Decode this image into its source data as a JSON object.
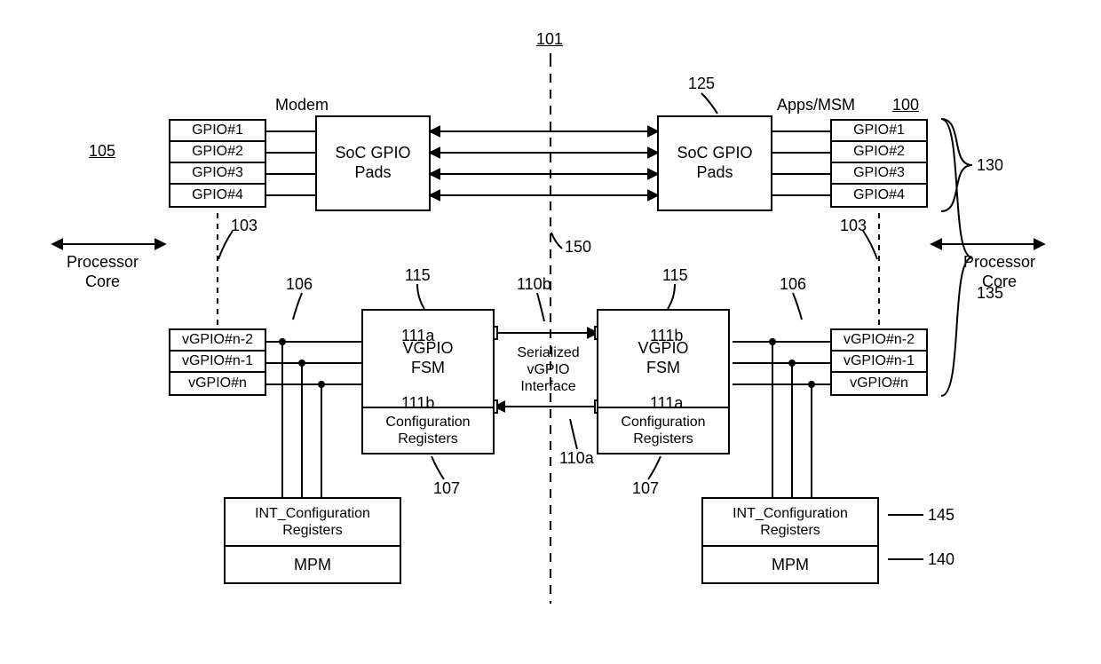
{
  "title_ref": "101",
  "left": {
    "header": "Modem",
    "ref_soc": "105",
    "gpio": [
      "GPIO#1",
      "GPIO#2",
      "GPIO#3",
      "GPIO#4"
    ],
    "vgpio": [
      "vGPIO#n-2",
      "vGPIO#n-1",
      "vGPIO#n"
    ],
    "soc_pads": "SoC GPIO\nPads",
    "proc": "Processor\nCore",
    "fsm": "VGPIO\nFSM",
    "cfg": "Configuration\nRegisters",
    "intcfg": "INT_Configuration\nRegisters",
    "mpm": "MPM"
  },
  "right": {
    "header": "Apps/MSM",
    "ref_soc": "100",
    "gpio": [
      "GPIO#1",
      "GPIO#2",
      "GPIO#3",
      "GPIO#4"
    ],
    "vgpio": [
      "vGPIO#n-2",
      "vGPIO#n-1",
      "vGPIO#n"
    ],
    "soc_pads": "SoC GPIO\nPads",
    "proc": "Processor\nCore",
    "fsm": "VGPIO\nFSM",
    "cfg": "Configuration\nRegisters",
    "intcfg": "INT_Configuration\nRegisters",
    "mpm": "MPM"
  },
  "center": {
    "ser_if": "Serialized\nvGPIO\nInterface"
  },
  "refs": {
    "r125": "125",
    "r130": "130",
    "r135": "135",
    "r140": "140",
    "r145": "145",
    "r150": "150",
    "r103": "103",
    "r106": "106",
    "r107": "107",
    "r115": "115",
    "r110a": "110a",
    "r110b": "110b",
    "r111a": "111a",
    "r111b": "111b"
  }
}
